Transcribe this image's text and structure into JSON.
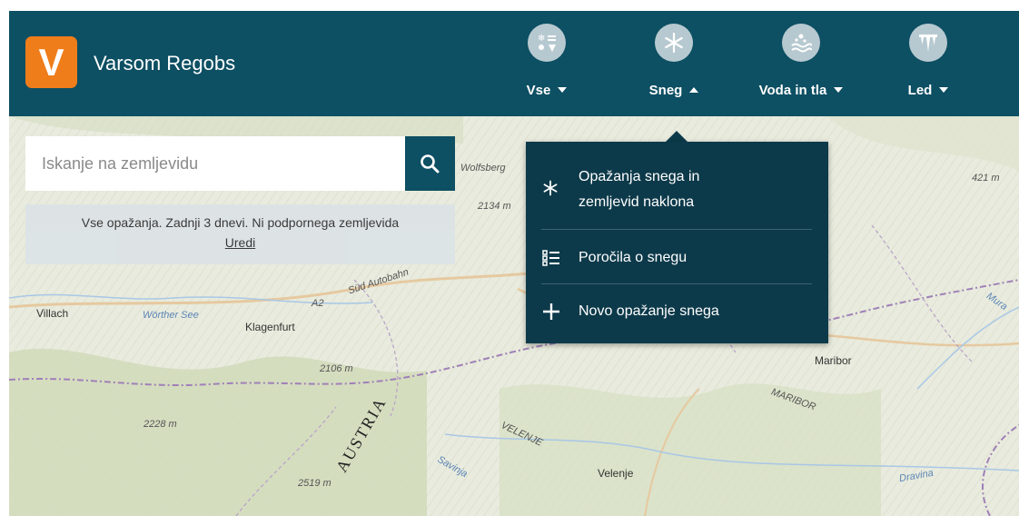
{
  "app": {
    "logo_letter": "V",
    "title": "Varsom Regobs",
    "brand_color": "#ef7d1a",
    "header_color": "#0d4f63"
  },
  "nav": [
    {
      "label": "Vse",
      "icon": "all-observations-icon",
      "expanded": false
    },
    {
      "label": "Sneg",
      "icon": "snowflake-icon",
      "expanded": true
    },
    {
      "label": "Voda in tla",
      "icon": "water-soil-icon",
      "expanded": false
    },
    {
      "label": "Led",
      "icon": "ice-icon",
      "expanded": false
    }
  ],
  "search": {
    "placeholder": "Iskanje na zemljevidu",
    "button_icon": "search-icon"
  },
  "filter": {
    "text": "Vse opažanja. Zadnji 3 dnevi. Ni podpornega zemljevida",
    "edit_label": "Uredi"
  },
  "dropdown": {
    "items": [
      {
        "line1": "Opažanja snega in",
        "line2": "zemljevid naklona",
        "icon": "snowflake-icon"
      },
      {
        "label": "Poročila o snegu",
        "icon": "list-icon"
      },
      {
        "label": "Novo opažanje snega",
        "icon": "plus-icon"
      }
    ]
  },
  "map": {
    "places": [
      "Wolfsberg",
      "Villach",
      "Klagenfurt",
      "Maribor",
      "MARIBOR",
      "Velenje",
      "VELENJE",
      "Wörther See",
      "Süd Autobahn",
      "A2",
      "Mura",
      "Dravina",
      "Savinja"
    ],
    "peaks": [
      "2134 m",
      "421 m",
      "2106 m",
      "2228 m",
      "2519 m"
    ],
    "country": "AUSTRIA"
  }
}
